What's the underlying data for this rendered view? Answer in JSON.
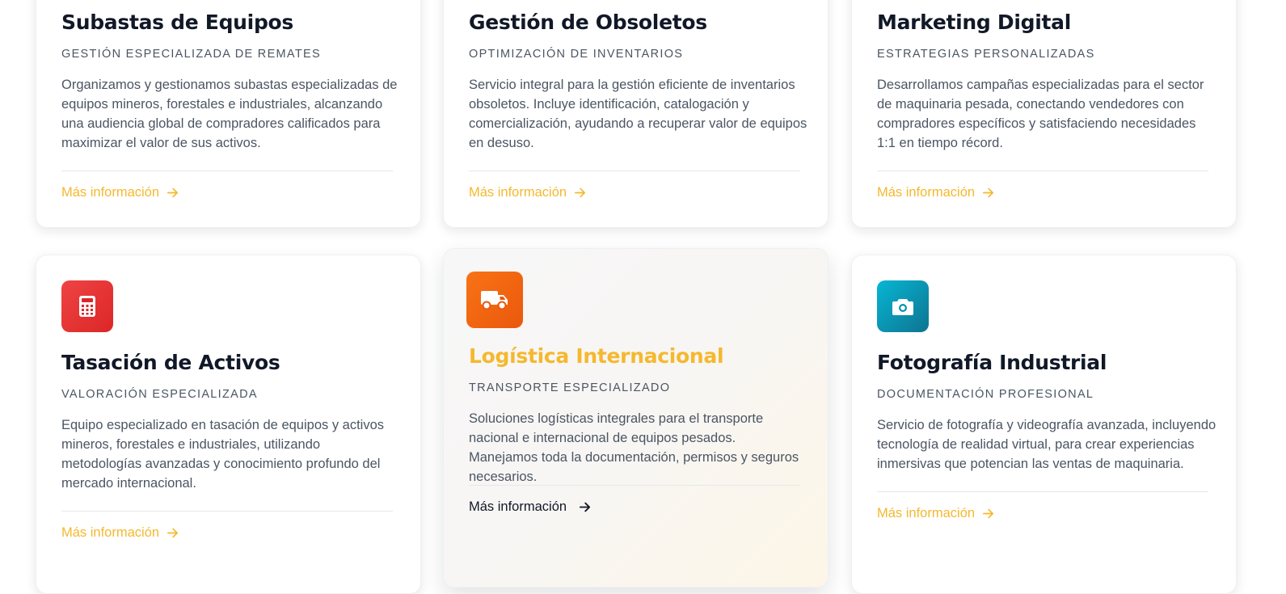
{
  "cards": [
    {
      "title": "Subastas de Equipos",
      "subtitle": "GESTIÓN ESPECIALIZADA DE REMATES",
      "description": "Organizamos y gestionamos subastas especializadas de equipos mineros, forestales e industriales, alcanzando una audiencia global de compradores calificados para maximizar el valor de sus activos.",
      "link": "Más información"
    },
    {
      "title": "Gestión de Obsoletos",
      "subtitle": "OPTIMIZACIÓN DE INVENTARIOS",
      "description": "Servicio integral para la gestión eficiente de inventarios obsoletos. Incluye identificación, catalogación y comercialización, ayudando a recuperar valor de equipos en desuso.",
      "link": "Más información"
    },
    {
      "title": "Marketing Digital",
      "subtitle": "ESTRATEGIAS PERSONALIZADAS",
      "description": "Desarrollamos campañas especializadas para el sector de maquinaria pesada, conectando vendedores con compradores específicos y satisfaciendo necesidades 1:1 en tiempo récord.",
      "link": "Más información"
    },
    {
      "title": "Tasación de Activos",
      "subtitle": "VALORACIÓN ESPECIALIZADA",
      "description": "Equipo especializado en tasación de equipos y activos mineros, forestales e industriales, utilizando metodologías avanzadas y conocimiento profundo del mercado internacional.",
      "link": "Más información",
      "icon": "calculator-icon",
      "icon_color": "#dc2626"
    },
    {
      "title": "Logística Internacional",
      "subtitle": "TRANSPORTE ESPECIALIZADO",
      "description": "Soluciones logísticas integrales para el transporte nacional e internacional de equipos pesados. Manejamos toda la documentación, permisos y seguros necesarios.",
      "link": "Más información",
      "icon": "truck-icon",
      "icon_color": "#f97316"
    },
    {
      "title": "Fotografía Industrial",
      "subtitle": "DOCUMENTACIÓN PROFESIONAL",
      "description": "Servicio de fotografía y videografía avanzada, incluyendo tecnología de realidad virtual, para crear experiencias inmersivas que potencian las ventas de maquinaria.",
      "link": "Más información",
      "icon": "camera-icon",
      "icon_color": "#0891b2"
    }
  ],
  "colors": {
    "accent": "#f5b82e",
    "heading": "#111827",
    "body_text": "#4b5563"
  }
}
